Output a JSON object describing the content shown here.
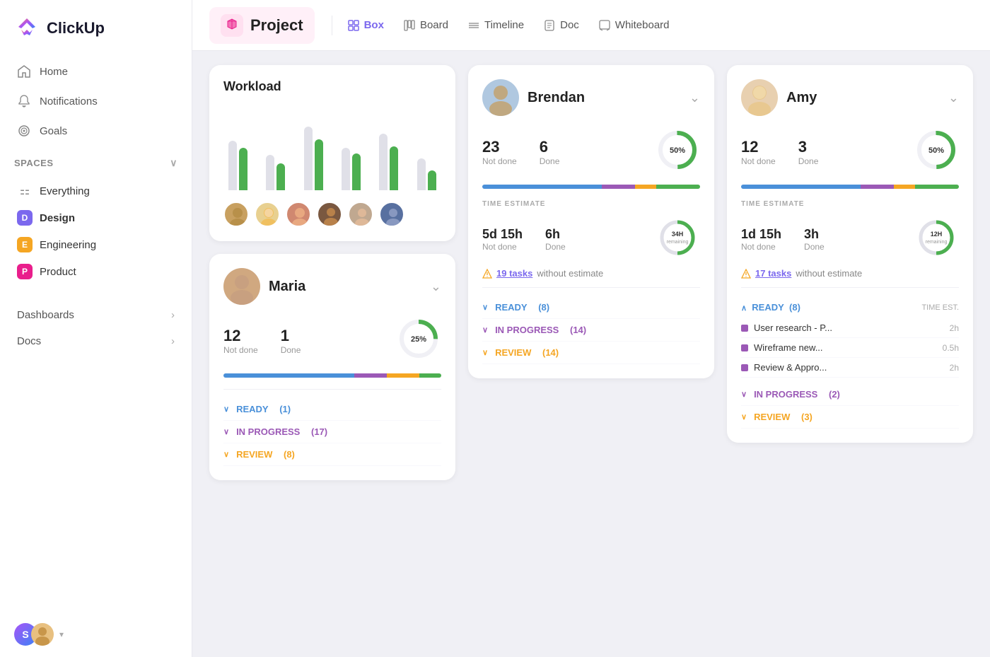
{
  "logo": {
    "text": "ClickUp"
  },
  "sidebar": {
    "nav": [
      {
        "id": "home",
        "label": "Home",
        "icon": "🏠"
      },
      {
        "id": "notifications",
        "label": "Notifications",
        "icon": "🔔"
      },
      {
        "id": "goals",
        "label": "Goals",
        "icon": "🎯"
      }
    ],
    "spaces_label": "Spaces",
    "spaces": [
      {
        "id": "everything",
        "label": "Everything",
        "prefix": "⚏",
        "type": "everything"
      },
      {
        "id": "design",
        "label": "Design",
        "letter": "D",
        "type": "space"
      },
      {
        "id": "engineering",
        "label": "Engineering",
        "letter": "E",
        "type": "space"
      },
      {
        "id": "product",
        "label": "Product",
        "letter": "P",
        "type": "space"
      }
    ],
    "bottom_links": [
      {
        "id": "dashboards",
        "label": "Dashboards"
      },
      {
        "id": "docs",
        "label": "Docs"
      }
    ]
  },
  "topnav": {
    "project_label": "Project",
    "views": [
      {
        "id": "box",
        "label": "Box",
        "active": true
      },
      {
        "id": "board",
        "label": "Board",
        "active": false
      },
      {
        "id": "timeline",
        "label": "Timeline",
        "active": false
      },
      {
        "id": "doc",
        "label": "Doc",
        "active": false
      },
      {
        "id": "whiteboard",
        "label": "Whiteboard",
        "active": false
      }
    ]
  },
  "workload": {
    "title": "Workload",
    "bars": [
      {
        "gray": 70,
        "green": 60
      },
      {
        "gray": 50,
        "green": 40
      },
      {
        "gray": 90,
        "green": 75
      },
      {
        "gray": 60,
        "green": 55
      },
      {
        "gray": 80,
        "green": 65
      },
      {
        "gray": 45,
        "green": 30
      }
    ]
  },
  "brendan": {
    "name": "Brendan",
    "not_done": 23,
    "not_done_label": "Not done",
    "done": 6,
    "done_label": "Done",
    "percent": "50%",
    "progress": [
      55,
      15,
      10,
      20
    ],
    "time_estimate_label": "TIME ESTIMATE",
    "time_not_done": "5d 15h",
    "time_done": "6h",
    "remaining": "34H",
    "remaining_label": "remaining",
    "time_not_done_label": "Not done",
    "time_done_label": "Done",
    "warning_count": "19 tasks",
    "warning_text": "without estimate",
    "statuses": [
      {
        "id": "ready",
        "label": "READY",
        "count": "(8)",
        "color": "ready"
      },
      {
        "id": "in_progress",
        "label": "IN PROGRESS",
        "count": "(14)",
        "color": "progress"
      },
      {
        "id": "review",
        "label": "REVIEW",
        "count": "(14)",
        "color": "review"
      }
    ]
  },
  "maria": {
    "name": "Maria",
    "not_done": 12,
    "not_done_label": "Not done",
    "done": 1,
    "done_label": "Done",
    "percent": "25%",
    "progress": [
      60,
      15,
      15,
      10
    ],
    "statuses": [
      {
        "id": "ready",
        "label": "READY",
        "count": "(1)",
        "color": "ready"
      },
      {
        "id": "in_progress",
        "label": "IN PROGRESS",
        "count": "(17)",
        "color": "progress"
      },
      {
        "id": "review",
        "label": "REVIEW",
        "count": "(8)",
        "color": "review"
      }
    ]
  },
  "amy": {
    "name": "Amy",
    "not_done": 12,
    "not_done_label": "Not done",
    "done": 3,
    "done_label": "Done",
    "percent": "50%",
    "progress": [
      55,
      15,
      10,
      20
    ],
    "time_estimate_label": "TIME ESTIMATE",
    "time_not_done": "1d 15h",
    "time_done": "3h",
    "remaining": "12H",
    "remaining_label": "remaining",
    "time_not_done_label": "Not done",
    "time_done_label": "Done",
    "warning_count": "17 tasks",
    "warning_text": "without estimate",
    "ready_label": "READY",
    "ready_count": "(8)",
    "time_est_label": "TIME EST.",
    "tasks": [
      {
        "name": "User research - P...",
        "time": "2h"
      },
      {
        "name": "Wireframe new...",
        "time": "0.5h"
      },
      {
        "name": "Review & Appro...",
        "time": "2h"
      }
    ],
    "in_progress_label": "IN PROGRESS",
    "in_progress_count": "(2)",
    "review_label": "REVIEW",
    "review_count": "(3)"
  }
}
